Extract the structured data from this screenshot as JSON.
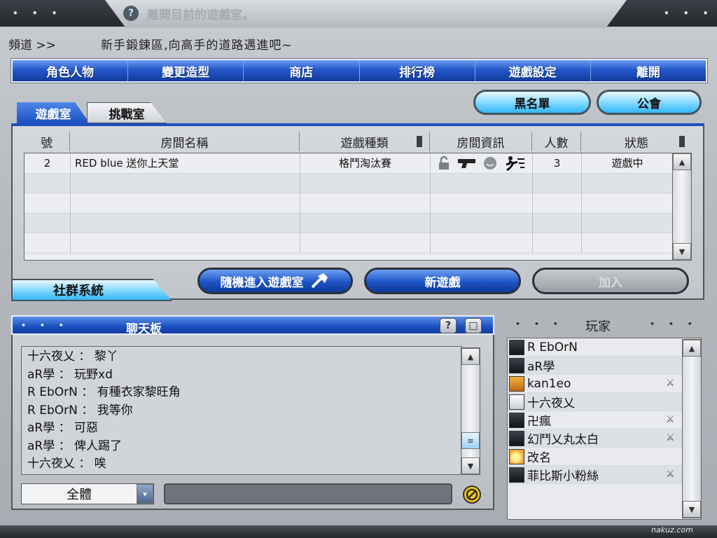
{
  "window": {
    "top_dots_left": "• • •",
    "top_dots_right": "• • •",
    "title_hint": "離開目前的遊戲室。",
    "help_glyph": "?"
  },
  "channel": {
    "label": "頻道 >>",
    "message": "新手鍛鍊區,向高手的道路邁進吧~"
  },
  "nav": {
    "items": [
      "角色人物",
      "變更造型",
      "商店",
      "排行榜",
      "遊戲設定",
      "離開"
    ]
  },
  "tabs": {
    "game_room": "遊戲室",
    "challenge_room": "挑戰室"
  },
  "top_buttons": {
    "blacklist": "黑名單",
    "guild": "公會"
  },
  "room_table": {
    "headers": [
      "號",
      "房間名稱",
      "遊戲種類",
      "房間資訊",
      "人數",
      "狀態"
    ],
    "rows": [
      {
        "no": "2",
        "name": "RED blue 送你上天堂",
        "type": "格鬥淘汰賽",
        "players": "3",
        "status": "遊戲中"
      }
    ]
  },
  "actions": {
    "random_join": "隨機進入遊戲室",
    "new_game": "新遊戲",
    "join": "加入"
  },
  "social_tab": "社群系統",
  "chat": {
    "title": "聊天板",
    "dots": "• • •",
    "lines": [
      "十六夜乂 ： 黎丫",
      "aR學 ： 玩野xd",
      "R EbOrN ： 有種衣家黎旺角",
      "R EbOrN ： 我等你",
      "aR學 ： 可惡",
      "aR學 ： 俾人踢了",
      "十六夜乂 ： 唉"
    ],
    "target_select": "全體",
    "input_value": ""
  },
  "players": {
    "title": "玩家",
    "dots": "• • •",
    "list": [
      {
        "name": "R EbOrN",
        "avatar": "dark",
        "flag": false
      },
      {
        "name": "aR學",
        "avatar": "dark",
        "flag": false
      },
      {
        "name": "kan1eo",
        "avatar": "orange",
        "flag": true
      },
      {
        "name": "十六夜乂",
        "avatar": "white",
        "flag": false
      },
      {
        "name": "卍瘋",
        "avatar": "dark",
        "flag": true
      },
      {
        "name": "幻鬥乂丸太白",
        "avatar": "dark",
        "flag": true
      },
      {
        "name": "改名",
        "avatar": "gold",
        "flag": false
      },
      {
        "name": "菲比斯小粉絲",
        "avatar": "dark",
        "flag": true
      }
    ]
  },
  "watermark": "nakuz.com",
  "colors": {
    "nav_blue": "#1a4fc0",
    "accent_cyan": "#7fd7ff",
    "frame_dark": "#25282d"
  }
}
